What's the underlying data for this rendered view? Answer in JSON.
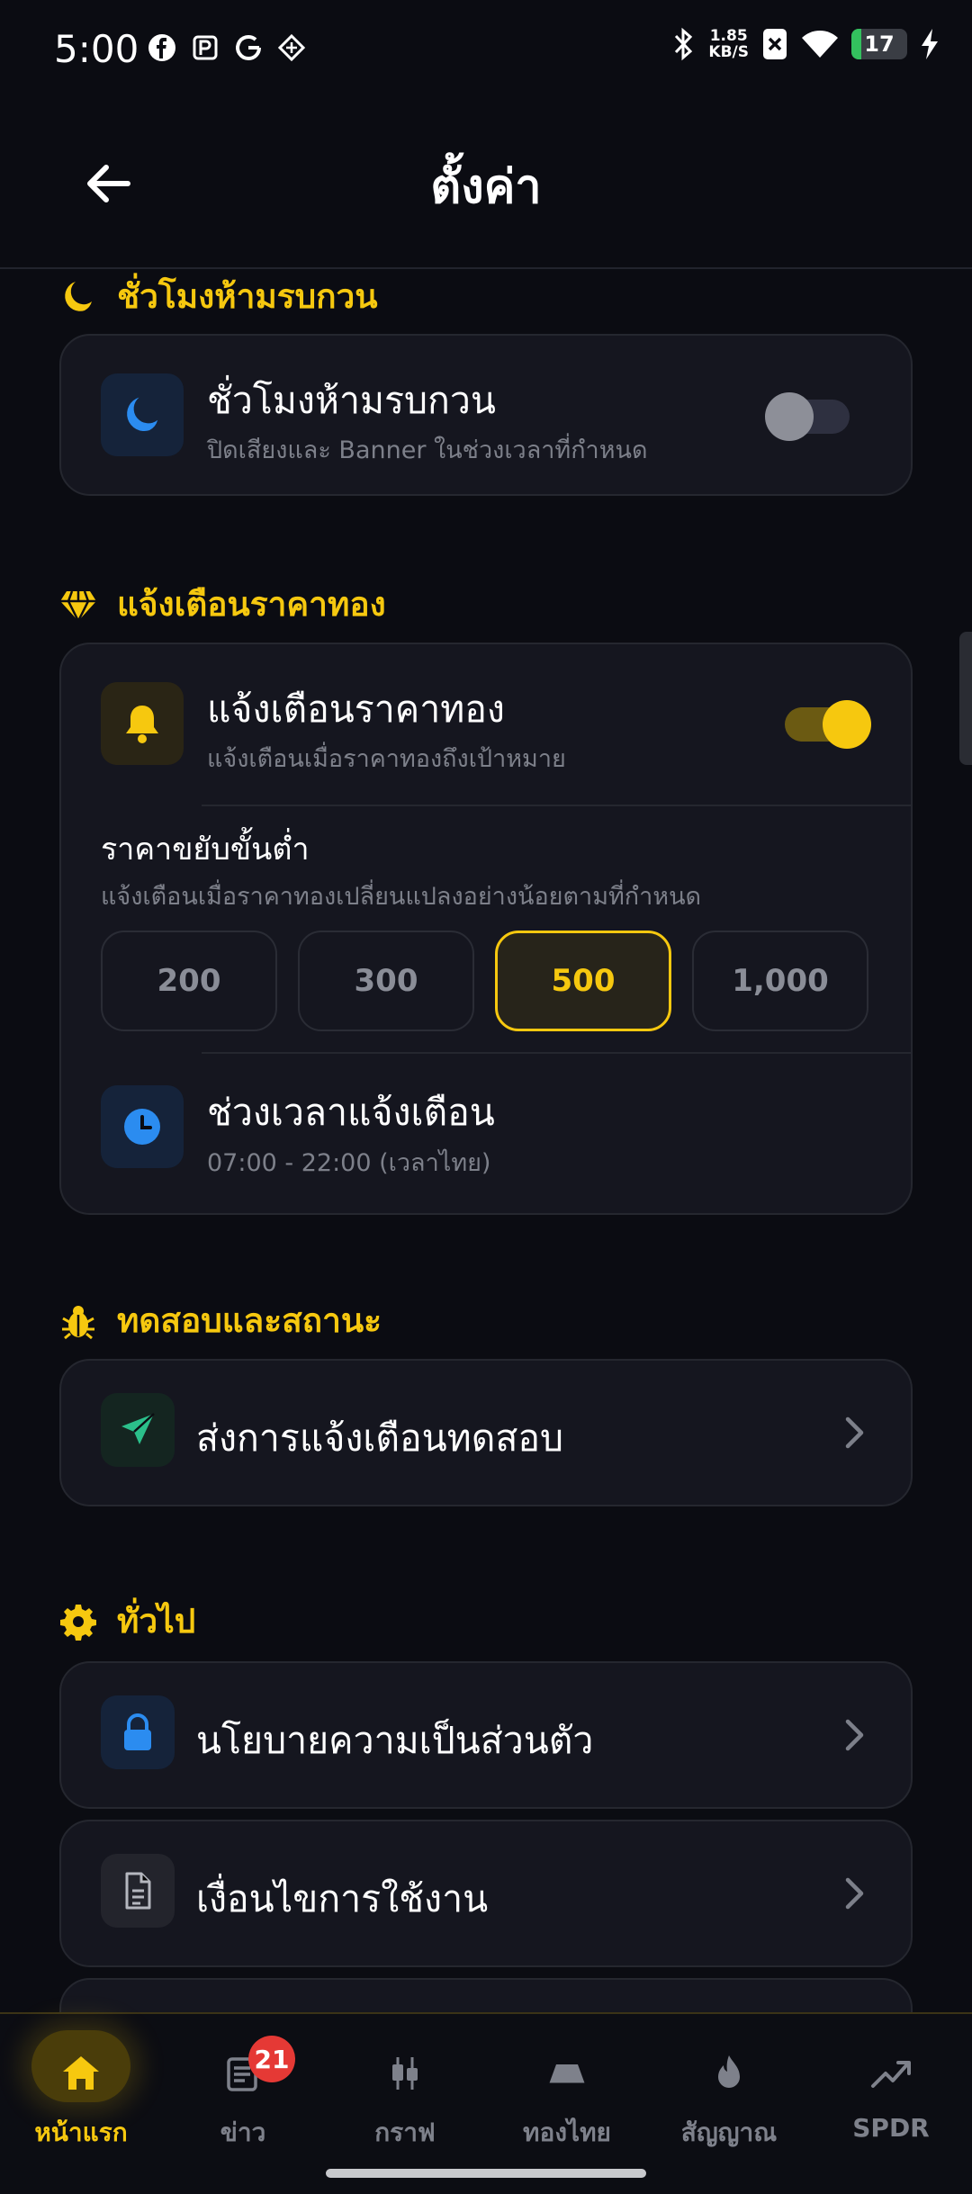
{
  "status_bar": {
    "time": "5:00",
    "net_speed_value": "1.85",
    "net_speed_unit": "KB/S",
    "battery_level": "17",
    "battery_fraction": 0.17,
    "icons_left": [
      "facebook-icon",
      "parking-app-icon",
      "google-icon",
      "app-diamond-icon"
    ],
    "icons_right": [
      "bluetooth-icon",
      "no-sim-icon",
      "wifi-icon",
      "battery-icon",
      "charging-icon"
    ]
  },
  "header": {
    "title": "ตั้งค่า",
    "back_icon": "arrow-left-icon"
  },
  "sections": {
    "dnd": {
      "title": "ชั่วโมงห้ามรบกวน",
      "row_title": "ชั่วโมงห้ามรบกวน",
      "row_subtitle": "ปิดเสียงและ Banner ในช่วงเวลาที่กำหนด",
      "toggle_on": false
    },
    "gold_alert": {
      "title": "แจ้งเตือนราคาทอง",
      "row_title": "แจ้งเตือนราคาทอง",
      "row_subtitle": "แจ้งเตือนเมื่อราคาทองถึงเป้าหมาย",
      "toggle_on": true,
      "min_step_title": "ราคาขยับขั้นต่ำ",
      "min_step_subtitle": "แจ้งเตือนเมื่อราคาทองเปลี่ยนแปลงอย่างน้อยตามที่กำหนด",
      "options": [
        "200",
        "300",
        "500",
        "1,000"
      ],
      "selected": "500",
      "time_title": "ช่วงเวลาแจ้งเตือน",
      "time_subtitle": "07:00 - 22:00 (เวลาไทย)"
    },
    "test": {
      "title": "ทดสอบและสถานะ",
      "row_title": "ส่งการแจ้งเตือนทดสอบ"
    },
    "general": {
      "title": "ทั่วไป",
      "items": [
        "นโยบายความเป็นส่วนตัว",
        "เงื่อนไขการใช้งาน"
      ]
    }
  },
  "bottom_nav": {
    "items": [
      {
        "label": "หน้าแรก",
        "icon": "home-icon",
        "active": true
      },
      {
        "label": "ข่าว",
        "icon": "news-icon",
        "badge": "21"
      },
      {
        "label": "กราฟ",
        "icon": "candlestick-chart-icon"
      },
      {
        "label": "ทองไทย",
        "icon": "gold-bar-icon"
      },
      {
        "label": "สัญญาณ",
        "icon": "flame-icon"
      },
      {
        "label": "SPDR",
        "icon": "trending-up-icon"
      }
    ]
  },
  "colors": {
    "accent": "#f6c80f",
    "background": "#0b0c12",
    "card": "#15161f",
    "blue_icon": "#2b8cf0",
    "green_icon": "#2bbf8a",
    "badge": "#e53935"
  }
}
